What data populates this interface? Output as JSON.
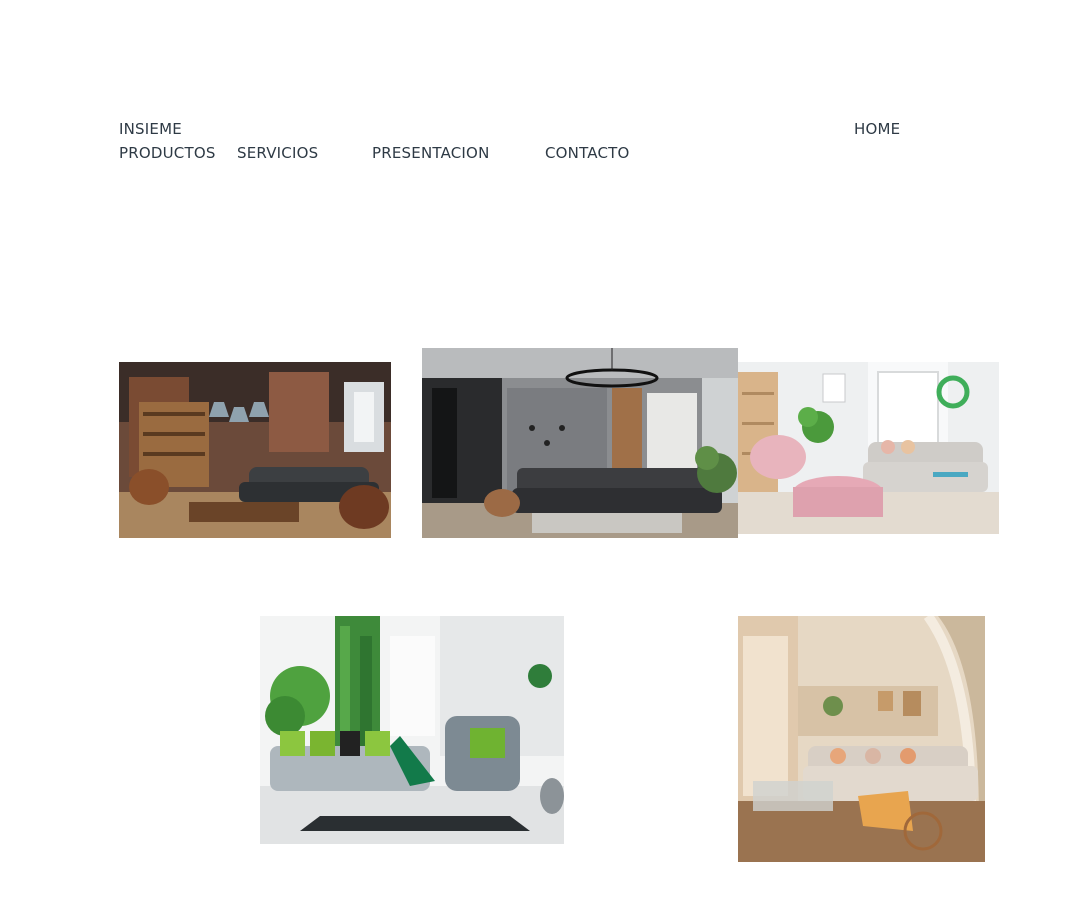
{
  "nav": {
    "brand_line1": "INSIEME",
    "brand_line2": "PRODUCTOS",
    "servicios": "SERVICIOS",
    "presentacion": "PRESENTACION",
    "contacto": "CONTACTO",
    "home": "HOME"
  },
  "gallery": {
    "images": [
      {
        "name": "loft-living-room-photo"
      },
      {
        "name": "modern-grey-living-room-photo"
      },
      {
        "name": "pastel-living-room-photo"
      },
      {
        "name": "green-wall-living-room-photo"
      },
      {
        "name": "arched-living-room-photo"
      }
    ]
  }
}
